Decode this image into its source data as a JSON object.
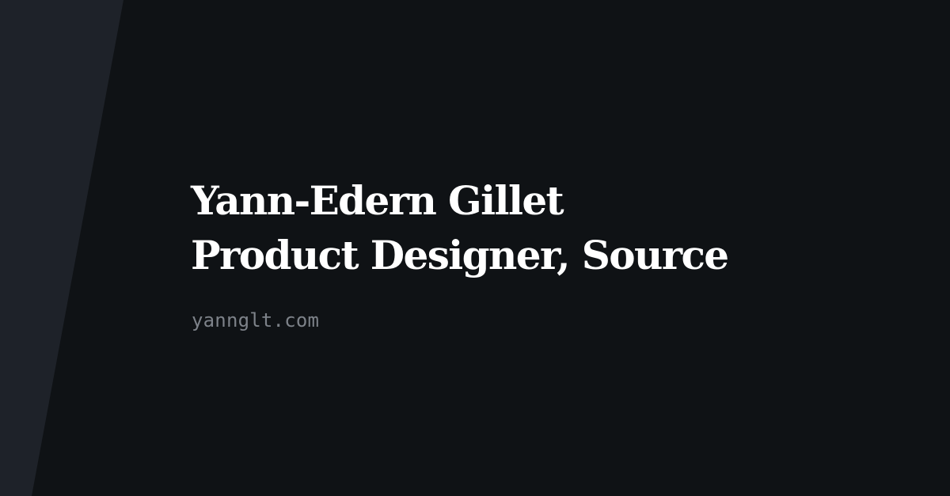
{
  "card": {
    "name": "Yann-Edern Gillet",
    "role": "Product Designer, Source",
    "site": "yannglt.com"
  },
  "colors": {
    "background": "#0f1215",
    "side_band": "#1e2229",
    "title_text": "#ffffff",
    "site_text": "#7d8289"
  }
}
